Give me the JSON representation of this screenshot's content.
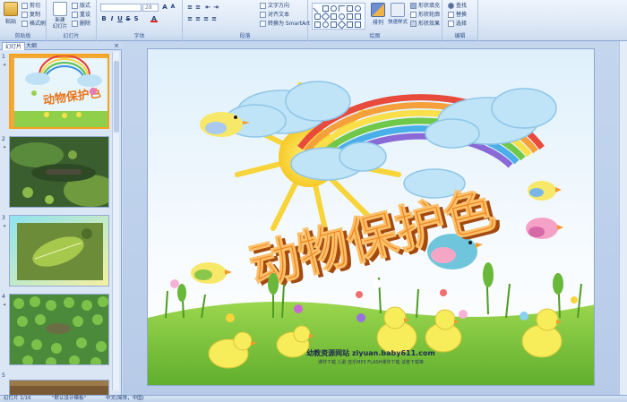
{
  "ribbon": {
    "groups": {
      "clipboard": "剪贴板",
      "slides": "幻灯片",
      "font": "字体",
      "paragraph": "段落",
      "drawing": "绘图",
      "editing": "编辑"
    },
    "paste_label": "粘贴",
    "cut_label": "剪切",
    "copy_label": "复制",
    "format_painter_label": "格式刷",
    "new_slide_label": "新建\n幻灯片",
    "layout_label": "版式",
    "reset_label": "重设",
    "delete_label": "删除",
    "font_name": "",
    "font_size": "28",
    "text_direction_label": "文字方向",
    "align_text_label": "对齐文本",
    "smartart_label": "转换为 SmartArt",
    "arrange_label": "排列",
    "quick_styles_label": "快速样式",
    "shape_fill_label": "形状填充",
    "shape_outline_label": "形状轮廓",
    "shape_effects_label": "形状效果",
    "find_label": "查找",
    "replace_label": "替换",
    "select_label": "选择"
  },
  "left_pane": {
    "tab_slides": "幻灯片",
    "tab_outline": "大纲",
    "close_glyph": "×",
    "slide_numbers": [
      "1",
      "2",
      "3",
      "4",
      "5"
    ]
  },
  "slide": {
    "title": "动物保护色",
    "website_line1": "幼教资源网站 ziyuan.baby611.com",
    "website_line2": "课件下载 儿歌 音乐MP3 FLASH课件下载 试卷下载等"
  },
  "status_bar": {
    "slide_counter": "幻灯片 1/16",
    "theme": "\"默认设计模板\"",
    "language": "中文(简体，中国)"
  },
  "colors": {
    "ribbon_bg": "#dde8f6",
    "sky_top": "#dff0fb",
    "grass": "#7cc43d",
    "title_orange": "#f2841c",
    "selection_orange": "#f6a21a"
  }
}
